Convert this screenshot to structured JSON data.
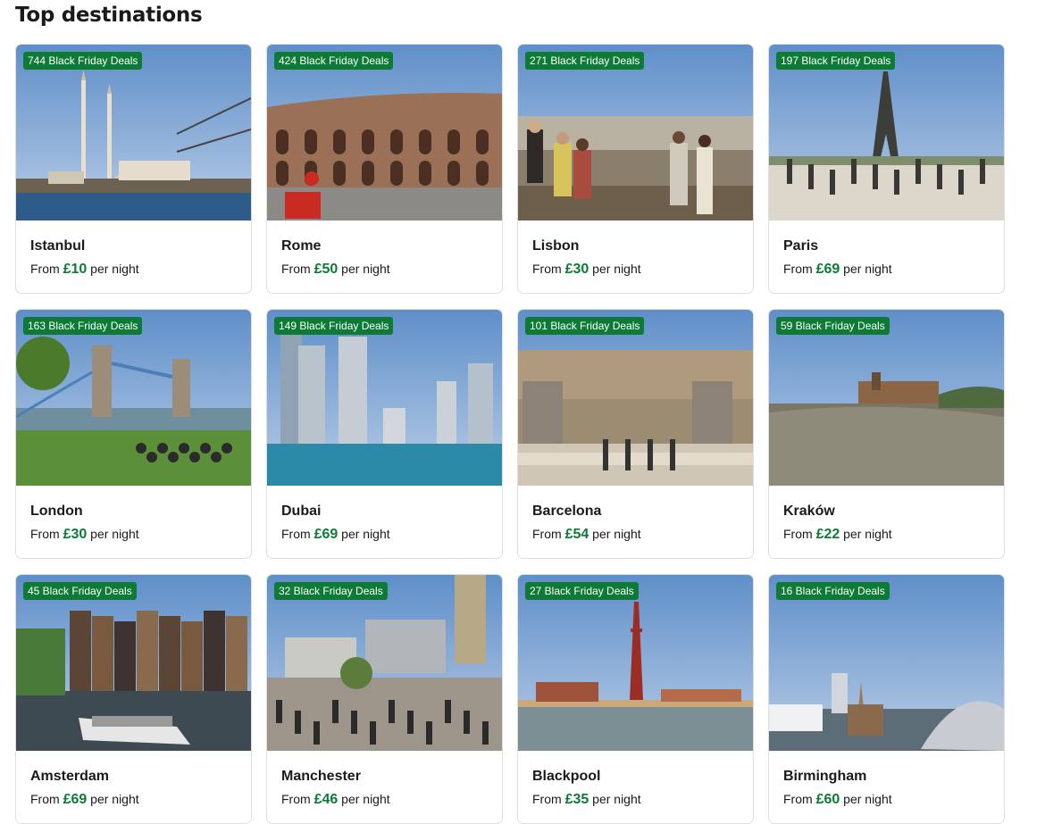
{
  "section": {
    "title": "Top destinations"
  },
  "labels": {
    "from": "From",
    "per_night": "per night"
  },
  "colors": {
    "deal_badge": "#0d7a36",
    "price": "#0d7a36"
  },
  "destinations": [
    {
      "city": "Istanbul",
      "deals": "744 Black Friday Deals",
      "price": "£10",
      "image_icon": "mosque-bosphorus-photo"
    },
    {
      "city": "Rome",
      "deals": "424 Black Friday Deals",
      "price": "£50",
      "image_icon": "colosseum-photo"
    },
    {
      "city": "Lisbon",
      "deals": "271 Black Friday Deals",
      "price": "£30",
      "image_icon": "viewpoint-photo"
    },
    {
      "city": "Paris",
      "deals": "197 Black Friday Deals",
      "price": "£69",
      "image_icon": "eiffel-tower-photo"
    },
    {
      "city": "London",
      "deals": "163 Black Friday Deals",
      "price": "£30",
      "image_icon": "tower-bridge-photo"
    },
    {
      "city": "Dubai",
      "deals": "149 Black Friday Deals",
      "price": "£69",
      "image_icon": "marina-skyline-photo"
    },
    {
      "city": "Barcelona",
      "deals": "101 Black Friday Deals",
      "price": "£54",
      "image_icon": "city-panorama-photo"
    },
    {
      "city": "Kraków",
      "deals": "59 Black Friday Deals",
      "price": "£22",
      "image_icon": "wawel-river-photo"
    },
    {
      "city": "Amsterdam",
      "deals": "45 Black Friday Deals",
      "price": "£69",
      "image_icon": "canal-boat-photo"
    },
    {
      "city": "Manchester",
      "deals": "32 Black Friday Deals",
      "price": "£46",
      "image_icon": "city-square-photo"
    },
    {
      "city": "Blackpool",
      "deals": "27 Black Friday Deals",
      "price": "£35",
      "image_icon": "blackpool-tower-photo"
    },
    {
      "city": "Birmingham",
      "deals": "16 Black Friday Deals",
      "price": "£60",
      "image_icon": "skyline-photo"
    }
  ]
}
